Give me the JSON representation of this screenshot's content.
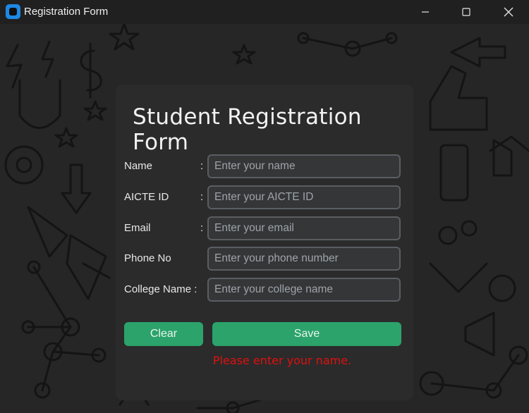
{
  "window": {
    "title": "Registration Form"
  },
  "form": {
    "title": "Student Registration Form",
    "fields": [
      {
        "label": "Name",
        "colon": ":",
        "placeholder": "Enter your name",
        "value": ""
      },
      {
        "label": "AICTE ID",
        "colon": ":",
        "placeholder": "Enter your AICTE ID",
        "value": ""
      },
      {
        "label": "Email",
        "colon": ":",
        "placeholder": "Enter your email",
        "value": ""
      },
      {
        "label": "Phone No",
        "colon": "",
        "placeholder": "Enter your phone number",
        "value": ""
      },
      {
        "label": "College Name :",
        "colon": "",
        "placeholder": "Enter your college name",
        "value": ""
      }
    ],
    "clear_label": "Clear",
    "save_label": "Save",
    "error_message": "Please enter your name."
  },
  "colors": {
    "accent_button": "#2ba36b",
    "error": "#e01010",
    "card_bg": "#2b2b2b",
    "input_bg": "#343638",
    "input_border": "#5a5e62",
    "app_icon": "#1e88e5"
  },
  "icons": {
    "app": "app-icon",
    "minimize": "minimize-icon",
    "maximize": "maximize-icon",
    "close": "close-icon"
  }
}
